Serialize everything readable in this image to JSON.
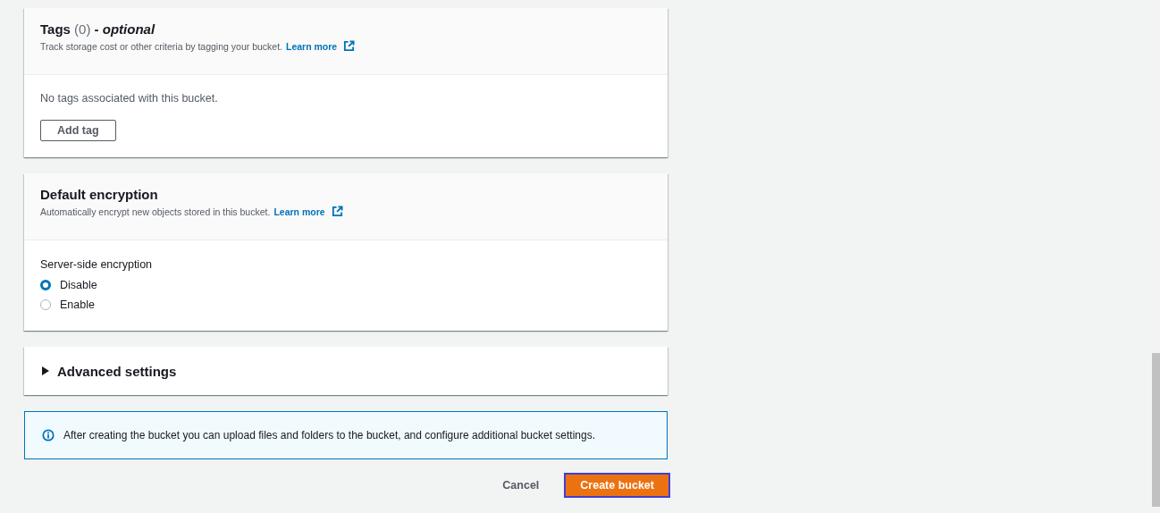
{
  "sections": [
    {
      "kind": "tags",
      "title": "Tags",
      "count": "(0)",
      "suffix": "- *optional*",
      "description": "Track storage cost or other criteria by tagging your bucket.",
      "link": "Learn more",
      "empty_text": "No tags associated with this bucket.",
      "button": "Add tag"
    },
    {
      "kind": "radio",
      "title": "Default encryption",
      "description": "Automatically encrypt new objects stored in this bucket.",
      "link": "Learn more",
      "group_label": "Server-side encryption",
      "options": [
        {
          "label": "Disable",
          "selected": true
        },
        {
          "label": "Enable",
          "selected": false
        }
      ]
    },
    {
      "kind": "expander",
      "title": "Advanced settings",
      "expanded": false
    }
  ],
  "info": "After creating the bucket you can upload files and folders to the bucket, and configure additional bucket settings.",
  "actions": {
    "cancel": "Cancel",
    "primary": "Create bucket"
  }
}
